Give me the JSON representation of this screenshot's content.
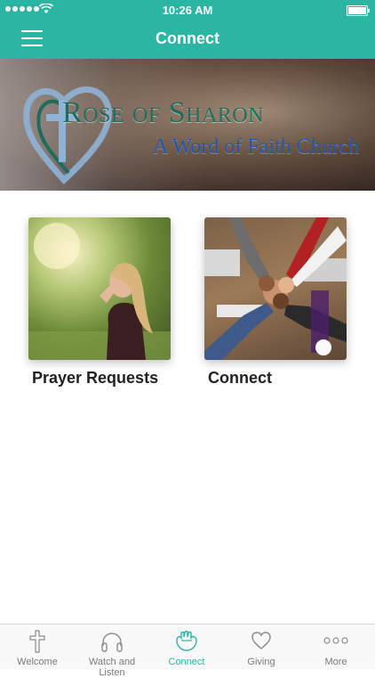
{
  "status_bar": {
    "time": "10:26 AM"
  },
  "nav": {
    "title": "Connect"
  },
  "banner": {
    "title": "Rose of Sharon",
    "subtitle": "A Word of Faith Church"
  },
  "cards": [
    {
      "label": "Prayer Requests"
    },
    {
      "label": "Connect"
    }
  ],
  "tabs": [
    {
      "label": "Welcome",
      "icon": "cross-icon"
    },
    {
      "label": "Watch and Listen",
      "icon": "headphones-icon"
    },
    {
      "label": "Connect",
      "icon": "hands-icon",
      "active": true
    },
    {
      "label": "Giving",
      "icon": "heart-icon"
    },
    {
      "label": "More",
      "icon": "more-icon"
    }
  ],
  "colors": {
    "accent": "#2bb6a3",
    "tab_inactive": "#7a7a7a",
    "banner_title": "#1f6b5c",
    "banner_subtitle": "#2456a8"
  }
}
